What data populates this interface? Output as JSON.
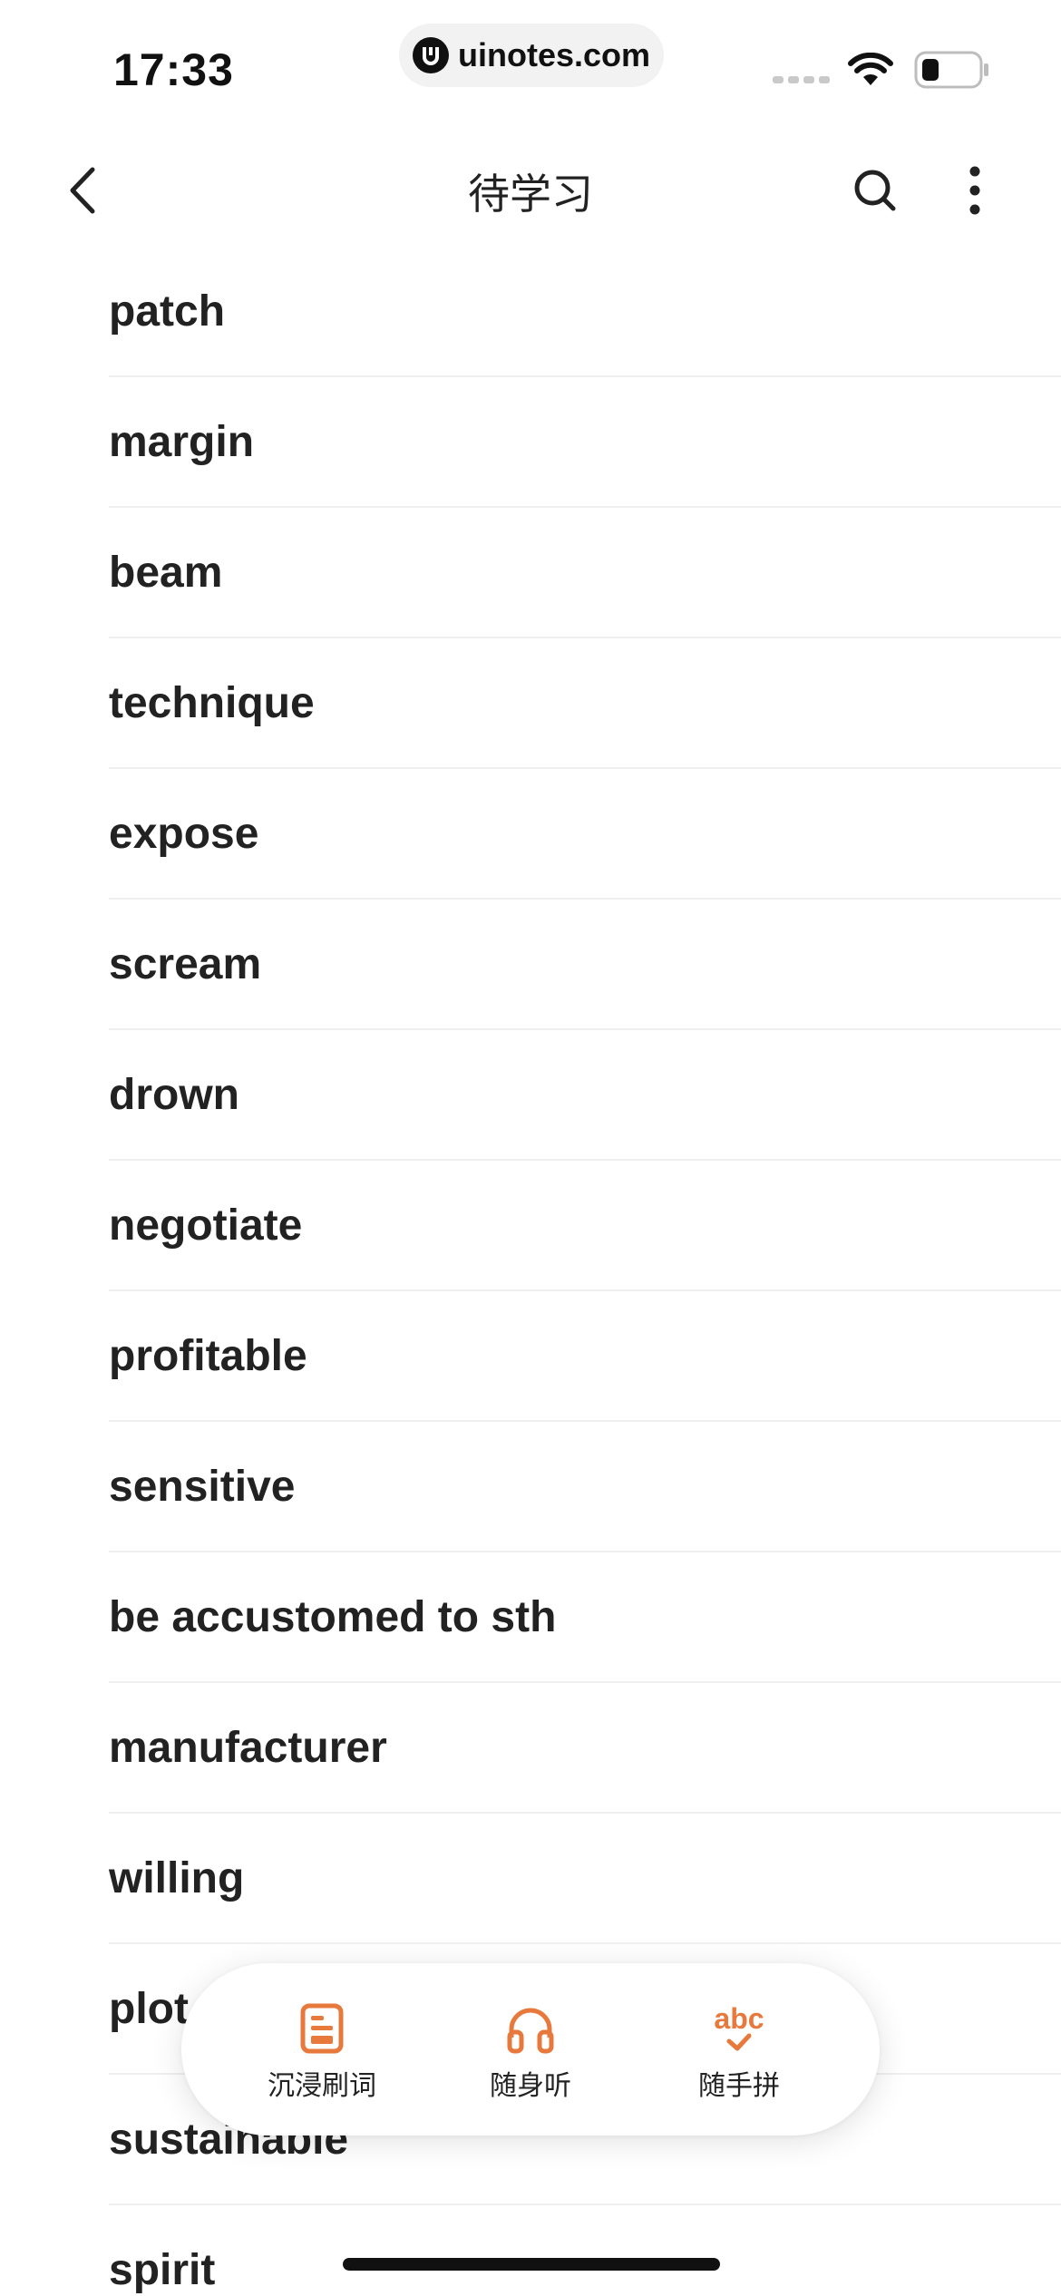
{
  "status": {
    "time": "17:33",
    "url": "uinotes.com"
  },
  "nav": {
    "title": "待学习"
  },
  "words": [
    "patch",
    "margin",
    "beam",
    "technique",
    "expose",
    "scream",
    "drown",
    "negotiate",
    "profitable",
    "sensitive",
    "be accustomed to sth",
    "manufacturer",
    "willing",
    "plot",
    "sustainable",
    "spirit"
  ],
  "actions": [
    {
      "label": "沉浸刷词",
      "icon": "document-icon"
    },
    {
      "label": "随身听",
      "icon": "headphones-icon"
    },
    {
      "label": "随手拼",
      "icon": "spelling-check-icon",
      "icon_text": "abc"
    }
  ],
  "colors": {
    "accent": "#e8793c",
    "text": "#222222",
    "divider": "#f0f0f0"
  }
}
